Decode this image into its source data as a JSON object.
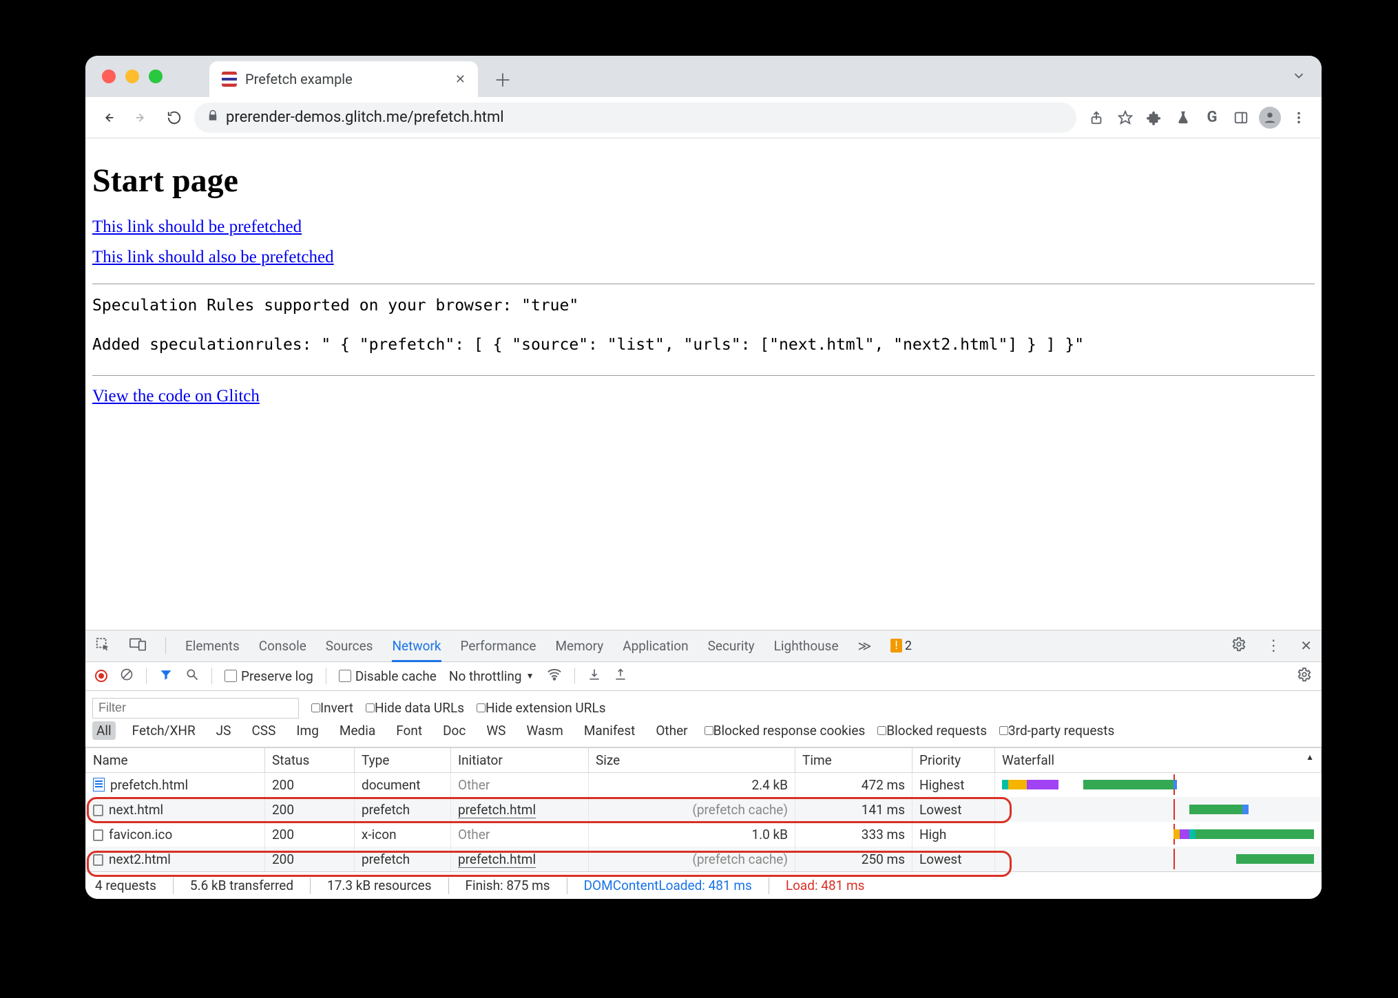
{
  "tab": {
    "title": "Prefetch example"
  },
  "url": "prerender-demos.glitch.me/prefetch.html",
  "page": {
    "heading": "Start page",
    "link1": "This link should be prefetched",
    "link2": "This link should also be prefetched",
    "code1": "Speculation Rules supported on your browser: \"true\"",
    "code2": "Added speculationrules: \" { \"prefetch\": [ { \"source\": \"list\", \"urls\": [\"next.html\", \"next2.html\"] } ] }\"",
    "link3": "View the code on Glitch"
  },
  "devtools": {
    "tabs": [
      "Elements",
      "Console",
      "Sources",
      "Network",
      "Performance",
      "Memory",
      "Application",
      "Security",
      "Lighthouse"
    ],
    "active": "Network",
    "warnCount": "2",
    "toolbar": {
      "preserve": "Preserve log",
      "disableCache": "Disable cache",
      "throttling": "No throttling"
    },
    "filter": {
      "placeholder": "Filter",
      "invert": "Invert",
      "hideData": "Hide data URLs",
      "hideExt": "Hide extension URLs",
      "types": [
        "All",
        "Fetch/XHR",
        "JS",
        "CSS",
        "Img",
        "Media",
        "Font",
        "Doc",
        "WS",
        "Wasm",
        "Manifest",
        "Other"
      ],
      "blockedCookies": "Blocked response cookies",
      "blockedReq": "Blocked requests",
      "thirdParty": "3rd-party requests"
    },
    "cols": [
      "Name",
      "Status",
      "Type",
      "Initiator",
      "Size",
      "Time",
      "Priority",
      "Waterfall"
    ],
    "rows": [
      {
        "name": "prefetch.html",
        "status": "200",
        "type": "document",
        "initiator": "Other",
        "initMuted": true,
        "size": "2.4 kB",
        "time": "472 ms",
        "priority": "Highest",
        "doc": true
      },
      {
        "name": "next.html",
        "status": "200",
        "type": "prefetch",
        "initiator": "prefetch.html",
        "initMuted": false,
        "size": "(prefetch cache)",
        "sizeMuted": true,
        "time": "141 ms",
        "priority": "Lowest"
      },
      {
        "name": "favicon.ico",
        "status": "200",
        "type": "x-icon",
        "initiator": "Other",
        "initMuted": true,
        "size": "1.0 kB",
        "time": "333 ms",
        "priority": "High"
      },
      {
        "name": "next2.html",
        "status": "200",
        "type": "prefetch",
        "initiator": "prefetch.html",
        "initMuted": false,
        "size": "(prefetch cache)",
        "sizeMuted": true,
        "time": "250 ms",
        "priority": "Lowest"
      }
    ],
    "status": {
      "requests": "4 requests",
      "transferred": "5.6 kB transferred",
      "resources": "17.3 kB resources",
      "finish": "Finish: 875 ms",
      "dcl": "DOMContentLoaded: 481 ms",
      "load": "Load: 481 ms"
    }
  }
}
